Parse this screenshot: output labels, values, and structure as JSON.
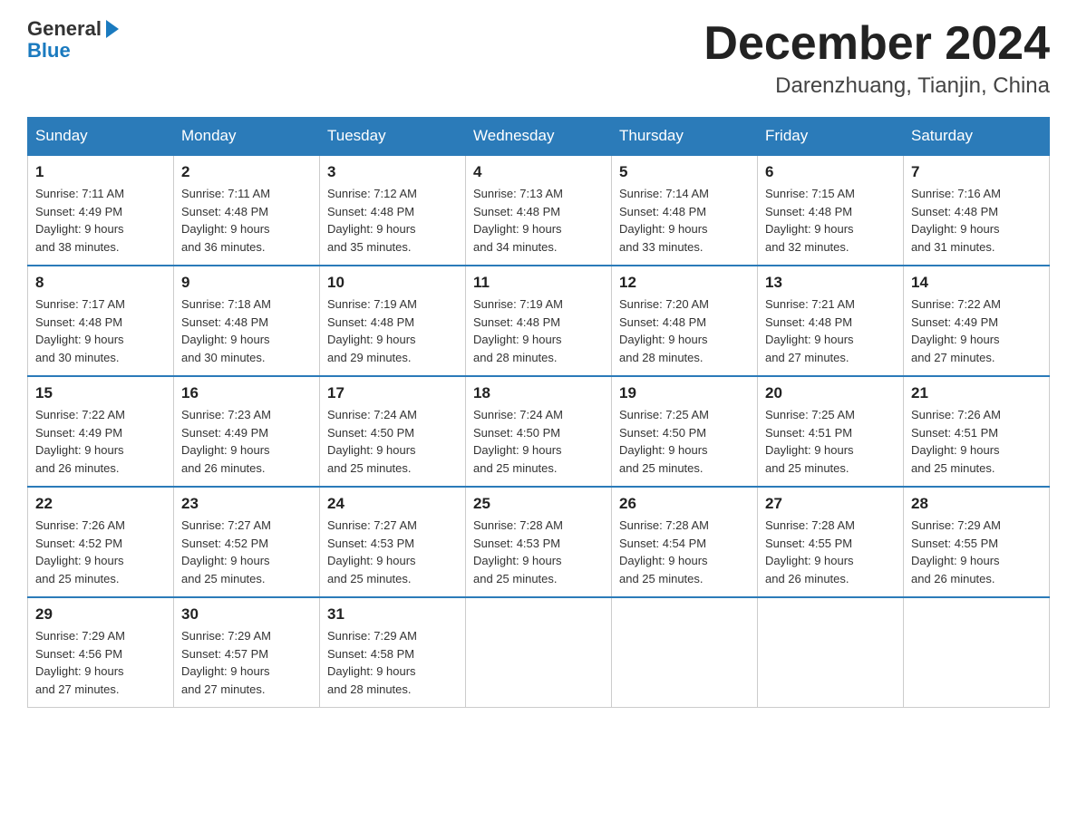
{
  "logo": {
    "general": "General",
    "blue": "Blue"
  },
  "header": {
    "month": "December 2024",
    "location": "Darenzhuang, Tianjin, China"
  },
  "weekdays": [
    "Sunday",
    "Monday",
    "Tuesday",
    "Wednesday",
    "Thursday",
    "Friday",
    "Saturday"
  ],
  "weeks": [
    [
      {
        "day": "1",
        "sunrise": "7:11 AM",
        "sunset": "4:49 PM",
        "daylight": "9 hours and 38 minutes."
      },
      {
        "day": "2",
        "sunrise": "7:11 AM",
        "sunset": "4:48 PM",
        "daylight": "9 hours and 36 minutes."
      },
      {
        "day": "3",
        "sunrise": "7:12 AM",
        "sunset": "4:48 PM",
        "daylight": "9 hours and 35 minutes."
      },
      {
        "day": "4",
        "sunrise": "7:13 AM",
        "sunset": "4:48 PM",
        "daylight": "9 hours and 34 minutes."
      },
      {
        "day": "5",
        "sunrise": "7:14 AM",
        "sunset": "4:48 PM",
        "daylight": "9 hours and 33 minutes."
      },
      {
        "day": "6",
        "sunrise": "7:15 AM",
        "sunset": "4:48 PM",
        "daylight": "9 hours and 32 minutes."
      },
      {
        "day": "7",
        "sunrise": "7:16 AM",
        "sunset": "4:48 PM",
        "daylight": "9 hours and 31 minutes."
      }
    ],
    [
      {
        "day": "8",
        "sunrise": "7:17 AM",
        "sunset": "4:48 PM",
        "daylight": "9 hours and 30 minutes."
      },
      {
        "day": "9",
        "sunrise": "7:18 AM",
        "sunset": "4:48 PM",
        "daylight": "9 hours and 30 minutes."
      },
      {
        "day": "10",
        "sunrise": "7:19 AM",
        "sunset": "4:48 PM",
        "daylight": "9 hours and 29 minutes."
      },
      {
        "day": "11",
        "sunrise": "7:19 AM",
        "sunset": "4:48 PM",
        "daylight": "9 hours and 28 minutes."
      },
      {
        "day": "12",
        "sunrise": "7:20 AM",
        "sunset": "4:48 PM",
        "daylight": "9 hours and 28 minutes."
      },
      {
        "day": "13",
        "sunrise": "7:21 AM",
        "sunset": "4:48 PM",
        "daylight": "9 hours and 27 minutes."
      },
      {
        "day": "14",
        "sunrise": "7:22 AM",
        "sunset": "4:49 PM",
        "daylight": "9 hours and 27 minutes."
      }
    ],
    [
      {
        "day": "15",
        "sunrise": "7:22 AM",
        "sunset": "4:49 PM",
        "daylight": "9 hours and 26 minutes."
      },
      {
        "day": "16",
        "sunrise": "7:23 AM",
        "sunset": "4:49 PM",
        "daylight": "9 hours and 26 minutes."
      },
      {
        "day": "17",
        "sunrise": "7:24 AM",
        "sunset": "4:50 PM",
        "daylight": "9 hours and 25 minutes."
      },
      {
        "day": "18",
        "sunrise": "7:24 AM",
        "sunset": "4:50 PM",
        "daylight": "9 hours and 25 minutes."
      },
      {
        "day": "19",
        "sunrise": "7:25 AM",
        "sunset": "4:50 PM",
        "daylight": "9 hours and 25 minutes."
      },
      {
        "day": "20",
        "sunrise": "7:25 AM",
        "sunset": "4:51 PM",
        "daylight": "9 hours and 25 minutes."
      },
      {
        "day": "21",
        "sunrise": "7:26 AM",
        "sunset": "4:51 PM",
        "daylight": "9 hours and 25 minutes."
      }
    ],
    [
      {
        "day": "22",
        "sunrise": "7:26 AM",
        "sunset": "4:52 PM",
        "daylight": "9 hours and 25 minutes."
      },
      {
        "day": "23",
        "sunrise": "7:27 AM",
        "sunset": "4:52 PM",
        "daylight": "9 hours and 25 minutes."
      },
      {
        "day": "24",
        "sunrise": "7:27 AM",
        "sunset": "4:53 PM",
        "daylight": "9 hours and 25 minutes."
      },
      {
        "day": "25",
        "sunrise": "7:28 AM",
        "sunset": "4:53 PM",
        "daylight": "9 hours and 25 minutes."
      },
      {
        "day": "26",
        "sunrise": "7:28 AM",
        "sunset": "4:54 PM",
        "daylight": "9 hours and 25 minutes."
      },
      {
        "day": "27",
        "sunrise": "7:28 AM",
        "sunset": "4:55 PM",
        "daylight": "9 hours and 26 minutes."
      },
      {
        "day": "28",
        "sunrise": "7:29 AM",
        "sunset": "4:55 PM",
        "daylight": "9 hours and 26 minutes."
      }
    ],
    [
      {
        "day": "29",
        "sunrise": "7:29 AM",
        "sunset": "4:56 PM",
        "daylight": "9 hours and 27 minutes."
      },
      {
        "day": "30",
        "sunrise": "7:29 AM",
        "sunset": "4:57 PM",
        "daylight": "9 hours and 27 minutes."
      },
      {
        "day": "31",
        "sunrise": "7:29 AM",
        "sunset": "4:58 PM",
        "daylight": "9 hours and 28 minutes."
      },
      null,
      null,
      null,
      null
    ]
  ],
  "labels": {
    "sunrise": "Sunrise:",
    "sunset": "Sunset:",
    "daylight": "Daylight:"
  },
  "colors": {
    "header_bg": "#2b7bb9",
    "border_top": "#2b7bb9"
  }
}
